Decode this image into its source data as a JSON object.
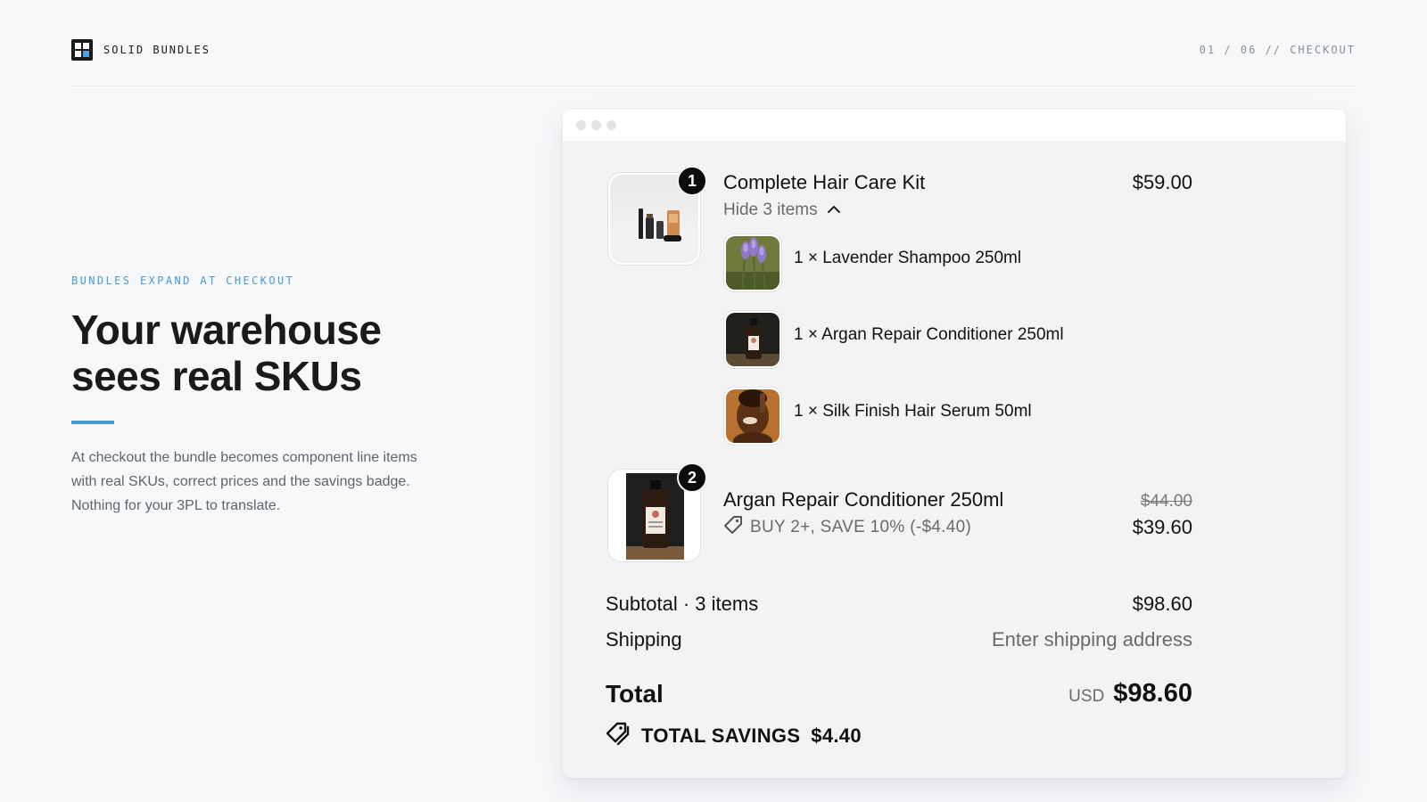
{
  "header": {
    "brand_name": "SOLID BUNDLES",
    "breadcrumb": "01 / 06 // CHECKOUT"
  },
  "hero": {
    "eyebrow": "BUNDLES EXPAND AT CHECKOUT",
    "headline": "Your warehouse sees real SKUs",
    "description": "At checkout the bundle becomes component line items with real SKUs, correct prices and the savings badge. Nothing for your 3PL to translate."
  },
  "checkout": {
    "line_items": [
      {
        "quantity_badge": "1",
        "title": "Complete Hair Care Kit",
        "price": "$59.00",
        "toggle_label": "Hide 3 items",
        "components": [
          {
            "label": "1 × Lavender Shampoo 250ml",
            "image": "lavender-flowers"
          },
          {
            "label": "1 × Argan Repair Conditioner 250ml",
            "image": "amber-bottle"
          },
          {
            "label": "1 × Silk Finish Hair Serum 50ml",
            "image": "model-portrait"
          }
        ]
      },
      {
        "quantity_badge": "2",
        "title": "Argan Repair Conditioner 250ml",
        "original_price": "$44.00",
        "price": "$39.60",
        "discount_label": "BUY 2+, SAVE 10% (-$4.40)",
        "discount_icon": "tag-icon"
      }
    ],
    "subtotal_label": "Subtotal · 3 items",
    "subtotal_value": "$98.60",
    "shipping_label": "Shipping",
    "shipping_value": "Enter shipping address",
    "total_label": "Total",
    "total_currency": "USD",
    "total_value": "$98.60",
    "savings_label": "TOTAL SAVINGS",
    "savings_value": "$4.40",
    "savings_icon": "tags-icon"
  },
  "colors": {
    "accent": "#4a9ad2",
    "page_background": "#f7f8fa",
    "panel_background": "#f3f3f4",
    "text": "#111111",
    "muted_text": "#6a6a6a"
  }
}
